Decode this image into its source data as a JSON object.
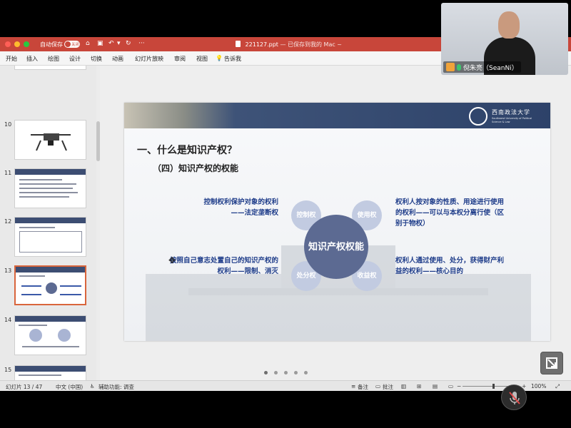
{
  "titlebar": {
    "autosave_label": "自动保存",
    "autosave_state": "关闭",
    "doc_title": "221127.ppt",
    "doc_status": "— 已保存到我的 Mac ~"
  },
  "menu": [
    "开始",
    "插入",
    "绘图",
    "设计",
    "切换",
    "动画",
    "幻灯片放映",
    "审阅",
    "视图",
    "告诉我"
  ],
  "thumbnails": [
    {
      "number": "10",
      "kind": "drone"
    },
    {
      "number": "11",
      "kind": "text"
    },
    {
      "number": "12",
      "kind": "table"
    },
    {
      "number": "13",
      "kind": "diagram",
      "selected": true
    },
    {
      "number": "14",
      "kind": "diagram2"
    },
    {
      "number": "15",
      "kind": "chart"
    }
  ],
  "slide": {
    "heading": "一、什么是知识产权？",
    "subheading": "（四）知识产权的权能",
    "university_name": "西南政法大学",
    "university_en": "Southwest University of Political Science & Law",
    "core_text": "知识产权权能",
    "petals": {
      "top_left": "控制权",
      "top_right": "使用权",
      "bottom_left": "处分权",
      "bottom_right": "收益权"
    },
    "annotations": {
      "top_left_1": "控制权利保护对象的权利",
      "top_left_2": "——法定垄断权",
      "top_right_1": "权利人按对象的性质、用途进行使用",
      "top_right_2": "的权利——可以与本权分离行使（区",
      "top_right_3": "别于物权）",
      "bottom_left_1": "按照自己意志处置自己的知识产权的",
      "bottom_left_2": "权利——限制、消灭",
      "bottom_right_1": "权利人通过使用、处分，获得财产利",
      "bottom_right_2": "益的权利——核心目的"
    }
  },
  "statusbar": {
    "slide_counter": "幻灯片 13 / 47",
    "language": "中文 (中国)",
    "accessibility": "辅助功能: 调查",
    "notes": "备注",
    "comments": "批注",
    "zoom": "100%"
  },
  "webcam": {
    "participant_name": "倪朱亮（SeanNi）"
  }
}
